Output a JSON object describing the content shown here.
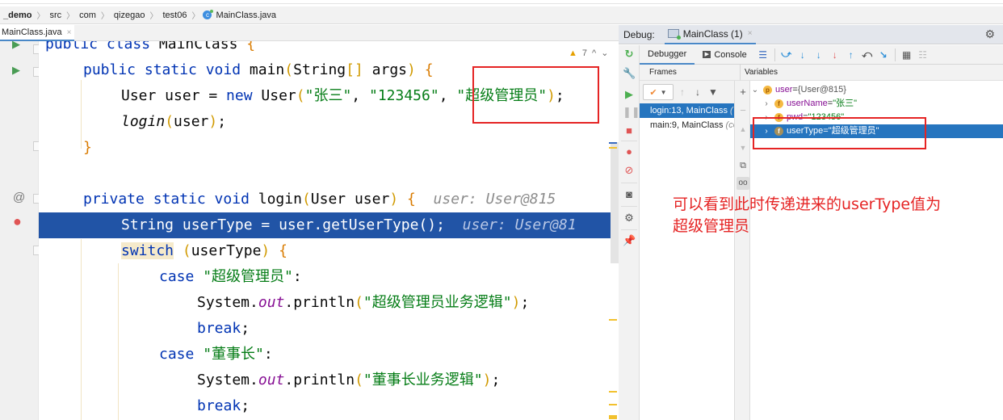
{
  "breadcrumb": {
    "items": [
      "_demo",
      "src",
      "com",
      "qizegao",
      "test06",
      "MainClass.java"
    ]
  },
  "editor": {
    "tab_label": "MainClass.java",
    "tab_close": "×",
    "inspections": {
      "warning_count": "7",
      "warning_icon": "▲",
      "up": "^",
      "down": "⌄"
    },
    "lines": {
      "l0": {
        "kw1": "public class ",
        "name": "MainClass ",
        "brace": "{"
      },
      "l1": {
        "kw1": "public static void ",
        "name": "main",
        "p1": "(",
        "args": "String",
        "br": "[]",
        "rest": " args",
        "p2": ")",
        "sp": " ",
        "brace": "{"
      },
      "l2": {
        "t1": "User user = ",
        "kw": "new ",
        "t2": "User",
        "p1": "(",
        "s1": "\"张三\"",
        "c1": ", ",
        "s2": "\"123456\"",
        "c2": ", ",
        "s3": "\"超级管理员\"",
        "p2": ")",
        "end": ";"
      },
      "l3": {
        "fn": "login",
        "p1": "(",
        "arg": "user",
        "p2": ")",
        "end": ";"
      },
      "l4": {
        "brace": "}"
      },
      "l5": {
        "kw": "private static void ",
        "name": "login",
        "p1": "(",
        "params": "User user",
        "p2": ")",
        "sp": " ",
        "brace": "{",
        "hint": "user: User@815"
      },
      "l6": {
        "code": "String userType = user.getUserType();",
        "hint": "user: User@81"
      },
      "l7": {
        "kw": "switch",
        "sp": " ",
        "p1": "(",
        "var": "userType",
        "p2": ")",
        "sp2": " ",
        "brace": "{"
      },
      "l8": {
        "kw": "case ",
        "str": "\"超级管理员\"",
        "end": ":"
      },
      "l9": {
        "t1": "System.",
        "field": "out",
        "t2": ".println",
        "p1": "(",
        "str": "\"超级管理员业务逻辑\"",
        "p2": ")",
        "end": ";"
      },
      "l10": {
        "kw": "break",
        "end": ";"
      },
      "l11": {
        "kw": "case ",
        "str": "\"董事长\"",
        "end": ":"
      },
      "l12": {
        "t1": "System.",
        "field": "out",
        "t2": ".println",
        "p1": "(",
        "str": "\"董事长业务逻辑\"",
        "p2": ")",
        "end": ";"
      },
      "l13": {
        "kw": "break",
        "end": ";"
      }
    },
    "gutter": {
      "run": "▶",
      "override": "@",
      "breakpoint": "●"
    }
  },
  "debug": {
    "label": "Debug:",
    "session_tab": "MainClass (1)",
    "session_close": "×",
    "gear": "⚙",
    "tabs": {
      "debugger": "Debugger",
      "console": "Console"
    },
    "toolbar_icons": {
      "menu": "☰",
      "show_execution_point": "⤻",
      "step_over": "↓",
      "step_into": "↓",
      "force_step_into": "↓",
      "step_out": "↑",
      "drop_frame": "⤺",
      "run_to_cursor": "↘",
      "evaluate": "▦",
      "trace": "☷"
    },
    "frames_header": "Frames",
    "variables_header": "Variables",
    "frames": [
      {
        "method": "login:13, MainClass",
        "loc": " ("
      },
      {
        "method": "main:9, MainClass",
        "loc": " (co"
      }
    ],
    "variables": [
      {
        "badge": "p",
        "name": "user",
        "eq": " = ",
        "value": "{User@815}",
        "arrow": "⌄"
      },
      {
        "badge": "f",
        "name": "userName",
        "eq": " = ",
        "value": "\"张三\"",
        "arrow": "›"
      },
      {
        "badge": "f",
        "name": "pwd",
        "eq": " = ",
        "value": "\"123456\"",
        "arrow": "›"
      },
      {
        "badge": "f",
        "name": "userType",
        "eq": " = ",
        "value": "\"超级管理员\"",
        "arrow": "›"
      }
    ]
  },
  "annotation": {
    "line1": "可以看到此时传递进来的userType值为",
    "line2": "超级管理员"
  },
  "colors": {
    "annotation_red": "#e52424",
    "selection_blue": "#2154a6",
    "keyword": "#0033b3",
    "string": "#067d17"
  }
}
